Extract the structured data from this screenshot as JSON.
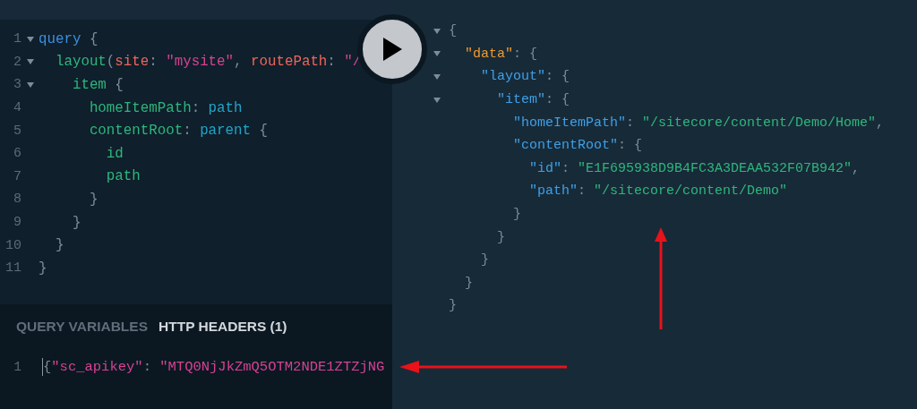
{
  "query_editor": {
    "lines": [
      {
        "number": "1",
        "foldable": true,
        "tokens": [
          {
            "kind": "keyword",
            "text": "query"
          },
          {
            "kind": "punct",
            "text": " {"
          }
        ]
      },
      {
        "number": "2",
        "foldable": true,
        "tokens": [
          {
            "kind": "field",
            "text": "  layout"
          },
          {
            "kind": "punct",
            "text": "("
          },
          {
            "kind": "arg",
            "text": "site"
          },
          {
            "kind": "punct",
            "text": ": "
          },
          {
            "kind": "string",
            "text": "\"mysite\""
          },
          {
            "kind": "punct",
            "text": ", "
          },
          {
            "kind": "arg",
            "text": "routePath"
          },
          {
            "kind": "punct",
            "text": ": "
          },
          {
            "kind": "string",
            "text": "\"/"
          }
        ]
      },
      {
        "number": "3",
        "foldable": true,
        "tokens": [
          {
            "kind": "field",
            "text": "    item"
          },
          {
            "kind": "punct",
            "text": " {"
          }
        ]
      },
      {
        "number": "4",
        "foldable": false,
        "tokens": [
          {
            "kind": "field",
            "text": "      homeItemPath"
          },
          {
            "kind": "punct",
            "text": ": "
          },
          {
            "kind": "alias",
            "text": "path"
          }
        ]
      },
      {
        "number": "5",
        "foldable": false,
        "tokens": [
          {
            "kind": "field",
            "text": "      contentRoot"
          },
          {
            "kind": "punct",
            "text": ": "
          },
          {
            "kind": "alias",
            "text": "parent"
          },
          {
            "kind": "punct",
            "text": " {"
          }
        ]
      },
      {
        "number": "6",
        "foldable": false,
        "tokens": [
          {
            "kind": "field",
            "text": "        id"
          }
        ]
      },
      {
        "number": "7",
        "foldable": false,
        "tokens": [
          {
            "kind": "field",
            "text": "        path"
          }
        ]
      },
      {
        "number": "8",
        "foldable": false,
        "tokens": [
          {
            "kind": "punct",
            "text": "      }"
          }
        ]
      },
      {
        "number": "9",
        "foldable": false,
        "tokens": [
          {
            "kind": "punct",
            "text": "    }"
          }
        ]
      },
      {
        "number": "10",
        "foldable": false,
        "tokens": [
          {
            "kind": "punct",
            "text": "  }"
          }
        ]
      },
      {
        "number": "11",
        "foldable": false,
        "tokens": [
          {
            "kind": "punct",
            "text": "}"
          }
        ]
      }
    ]
  },
  "variables_panel": {
    "tabs": [
      {
        "label": "QUERY VARIABLES",
        "selected": false
      },
      {
        "label": "HTTP HEADERS (1)",
        "selected": true
      }
    ],
    "lines": [
      {
        "number": "1",
        "tokens": [
          {
            "kind": "punct",
            "text": "{"
          },
          {
            "kind": "key",
            "text": "\"sc_apikey\""
          },
          {
            "kind": "punct",
            "text": ": "
          },
          {
            "kind": "key",
            "text": "\"MTQ0NjJkZmQ5OTM2NDE1ZTZjNG"
          }
        ]
      }
    ]
  },
  "result_viewer": {
    "lines": [
      {
        "foldable": true,
        "tokens": [
          {
            "kind": "punct",
            "text": "{"
          }
        ]
      },
      {
        "foldable": true,
        "tokens": [
          {
            "kind": "datakey",
            "text": "  \"data\""
          },
          {
            "kind": "punct",
            "text": ": {"
          }
        ]
      },
      {
        "foldable": true,
        "tokens": [
          {
            "kind": "key",
            "text": "    \"layout\""
          },
          {
            "kind": "punct",
            "text": ": {"
          }
        ]
      },
      {
        "foldable": true,
        "tokens": [
          {
            "kind": "key",
            "text": "      \"item\""
          },
          {
            "kind": "punct",
            "text": ": {"
          }
        ]
      },
      {
        "foldable": false,
        "tokens": [
          {
            "kind": "key",
            "text": "        \"homeItemPath\""
          },
          {
            "kind": "punct",
            "text": ": "
          },
          {
            "kind": "string",
            "text": "\"/sitecore/content/Demo/Home\""
          },
          {
            "kind": "punct",
            "text": ","
          }
        ]
      },
      {
        "foldable": false,
        "tokens": [
          {
            "kind": "key",
            "text": "        \"contentRoot\""
          },
          {
            "kind": "punct",
            "text": ": {"
          }
        ]
      },
      {
        "foldable": false,
        "tokens": [
          {
            "kind": "key",
            "text": "          \"id\""
          },
          {
            "kind": "punct",
            "text": ": "
          },
          {
            "kind": "string",
            "text": "\"E1F695938D9B4FC3A3DEAA532F07B942\""
          },
          {
            "kind": "punct",
            "text": ","
          }
        ]
      },
      {
        "foldable": false,
        "tokens": [
          {
            "kind": "key",
            "text": "          \"path\""
          },
          {
            "kind": "punct",
            "text": ": "
          },
          {
            "kind": "string",
            "text": "\"/sitecore/content/Demo\""
          }
        ]
      },
      {
        "foldable": false,
        "tokens": [
          {
            "kind": "punct",
            "text": "        }"
          }
        ]
      },
      {
        "foldable": false,
        "tokens": [
          {
            "kind": "punct",
            "text": "      }"
          }
        ]
      },
      {
        "foldable": false,
        "tokens": [
          {
            "kind": "punct",
            "text": "    }"
          }
        ]
      },
      {
        "foldable": false,
        "tokens": [
          {
            "kind": "punct",
            "text": "  }"
          }
        ]
      },
      {
        "foldable": false,
        "tokens": [
          {
            "kind": "punct",
            "text": "}"
          }
        ]
      }
    ]
  }
}
